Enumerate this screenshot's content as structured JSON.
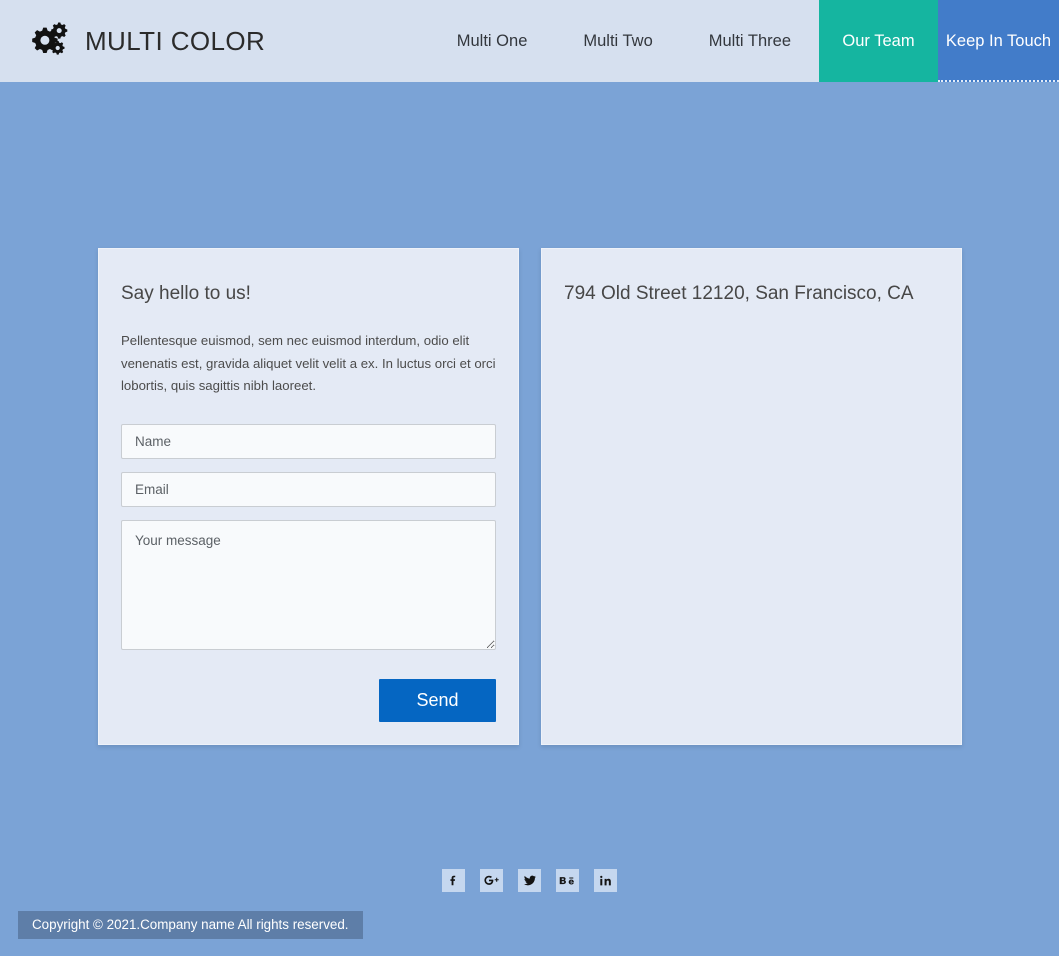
{
  "header": {
    "brand": {
      "icon": "cogs-icon",
      "title": "MULTI COLOR"
    },
    "nav": [
      {
        "label": "Multi One",
        "style": "plain",
        "icon": null
      },
      {
        "label": "Multi Two",
        "style": "plain",
        "icon": null
      },
      {
        "label": "Multi Three",
        "style": "plain",
        "icon": null
      },
      {
        "label": "Our Team",
        "style": "accent-teal",
        "icon": null
      },
      {
        "label": "Keep In Touch",
        "style": "accent-blue",
        "icon": null
      }
    ]
  },
  "contact_card": {
    "title": "Say hello to us!",
    "description": "Pellentesque euismod, sem nec euismod interdum, odio elit venenatis est, gravida aliquet velit velit a ex. In luctus orci et orci lobortis, quis sagittis nibh laoreet.",
    "fields": {
      "name": {
        "placeholder": "Name",
        "value": ""
      },
      "email": {
        "placeholder": "Email",
        "value": ""
      },
      "message": {
        "placeholder": "Your message",
        "value": ""
      }
    },
    "submit_label": "Send"
  },
  "map_card": {
    "address": "794 Old Street 12120, San Francisco, CA"
  },
  "social": [
    {
      "name": "facebook-icon",
      "glyph": "f"
    },
    {
      "name": "google-plus-icon",
      "glyph": "G+"
    },
    {
      "name": "twitter-icon",
      "glyph": "bird"
    },
    {
      "name": "behance-icon",
      "glyph": "Bē"
    },
    {
      "name": "linkedin-icon",
      "glyph": "in"
    }
  ],
  "footer": {
    "copyright": "Copyright © 2021.Company name All rights reserved."
  },
  "colors": {
    "page_background": "#7ba3d6",
    "header_background": "#d6e0ef",
    "card_background": "#e4eaf5",
    "accent_teal": "#15b5a0",
    "accent_blue": "#427cc9",
    "button_blue": "#0566c2",
    "copyright_bar": "#5e7ea8",
    "social_tile": "#c5d7ef"
  }
}
